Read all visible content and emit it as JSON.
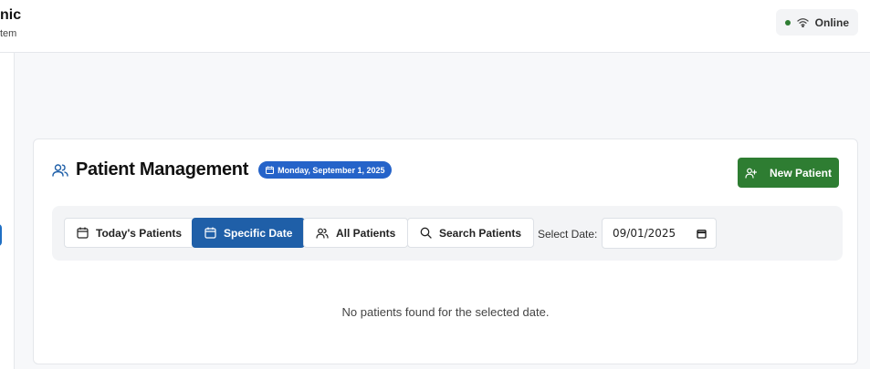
{
  "header": {
    "brand_title": "nic",
    "brand_subtitle": "tem",
    "status_label": "Online",
    "status_color": "#2e7d32"
  },
  "card": {
    "title": "Patient Management",
    "date_badge": "Monday, September 1, 2025",
    "new_patient_label": "New Patient",
    "accent_blue": "#1f5fa8",
    "accent_green": "#2e7d32"
  },
  "filters": {
    "todays_patients": "Today's Patients",
    "specific_date": "Specific Date",
    "all_patients": "All Patients",
    "search_patients": "Search Patients",
    "select_date_label": "Select Date:",
    "date_value": "09/01/2025",
    "active": "Specific Date"
  },
  "empty_message": "No patients found for the selected date."
}
